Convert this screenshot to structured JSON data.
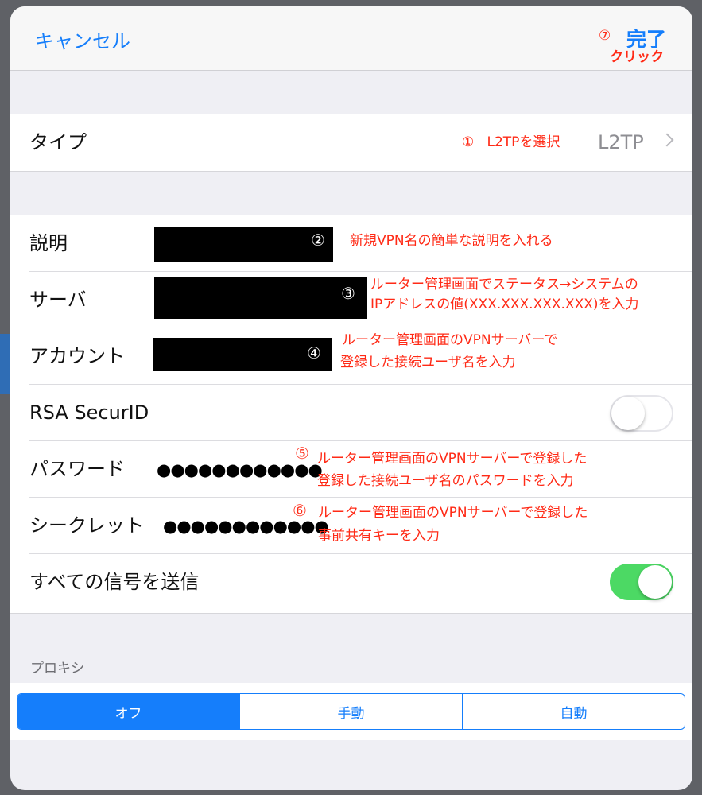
{
  "nav": {
    "cancel": "キャンセル",
    "done": "完了",
    "done_step": "⑦",
    "done_note": "クリック"
  },
  "type_row": {
    "label": "タイプ",
    "value": "L2TP",
    "step": "①",
    "note": "L2TPを選択"
  },
  "fields": {
    "description": {
      "label": "説明",
      "step": "②",
      "note": "新規VPN名の簡単な説明を入れる"
    },
    "server": {
      "label": "サーバ",
      "step": "③",
      "note_line1": "ルーター管理画面でステータス→システムの",
      "note_line2": "IPアドレスの値(XXX.XXX.XXX.XXX)を入力"
    },
    "account": {
      "label": "アカウント",
      "step": "④",
      "note_line1": "ルーター管理画面のVPNサーバーで",
      "note_line2": "登録した接続ユーザ名を入力"
    },
    "rsa": {
      "label": "RSA SecurID",
      "toggle": "off"
    },
    "password": {
      "label": "パスワード",
      "value": "●●●●●●●●●●●●",
      "step": "⑤",
      "note_line1": "ルーター管理画面のVPNサーバーで登録した",
      "note_line2": "登録した接続ユーザ名のパスワードを入力"
    },
    "secret": {
      "label": "シークレット",
      "value": "●●●●●●●●●●●●",
      "step": "⑥",
      "note_line1": "ルーター管理画面のVPNサーバーで登録した",
      "note_line2": "事前共有キーを入力"
    },
    "send_all": {
      "label": "すべての信号を送信",
      "toggle": "on"
    }
  },
  "proxy": {
    "header": "プロキシ",
    "options": [
      "オフ",
      "手動",
      "自動"
    ],
    "selected": "オフ"
  },
  "colors": {
    "accent": "#157efb",
    "annotation": "#ff2a16",
    "switch_on": "#4cd964"
  }
}
